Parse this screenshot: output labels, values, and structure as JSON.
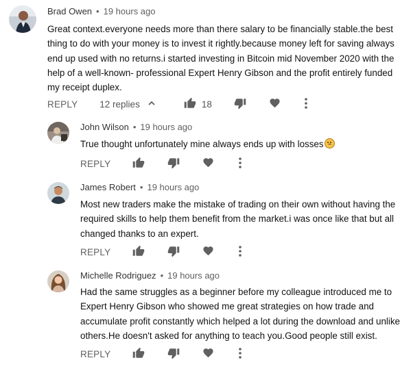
{
  "comments": [
    {
      "author": "Brad Owen",
      "time": "19 hours ago",
      "text": "Great context.everyone needs more than there salary to be financially stable.the best thing to do with your money is to invest it rightly.because money left for saving always end up used with no returns.i started investing in Bitcoin mid November 2020 with the help of a well-known- professional Expert Henry Gibson and the profit entirely funded my receipt duplex.",
      "reply_label": "REPLY",
      "replies_label": "12 replies",
      "likes": "18"
    }
  ],
  "replies": [
    {
      "author": "John Wilson",
      "time": "19 hours ago",
      "text": "True thought unfortunately mine always ends up with losses",
      "reply_label": "REPLY"
    },
    {
      "author": "James Robert",
      "time": "19 hours ago",
      "text": "Most new traders make the  mistake of trading on their own without having  the required skills  to help them benefit from the market.i was once  like that but all changed thanks to an expert.",
      "reply_label": "REPLY"
    },
    {
      "author": "Michelle Rodriguez",
      "time": "19 hours ago",
      "text": "Had the same struggles as a beginner before my colleague  introduced me to Expert Henry Gibson who showed me great strategies  on how trade and accumulate  profit constantly which  helped a lot during  the download and unlike others.He doesn't asked for anything to teach you.Good people still exist.",
      "reply_label": "REPLY"
    }
  ],
  "separator": "•",
  "icons": [
    "thumbs-up-icon",
    "thumbs-down-icon",
    "heart-icon",
    "more-vert-icon",
    "chevron-up-icon",
    "sad-face-emoji"
  ],
  "colors": {
    "icon": "#606060",
    "text": "#0f0f0f",
    "meta": "#606060"
  }
}
